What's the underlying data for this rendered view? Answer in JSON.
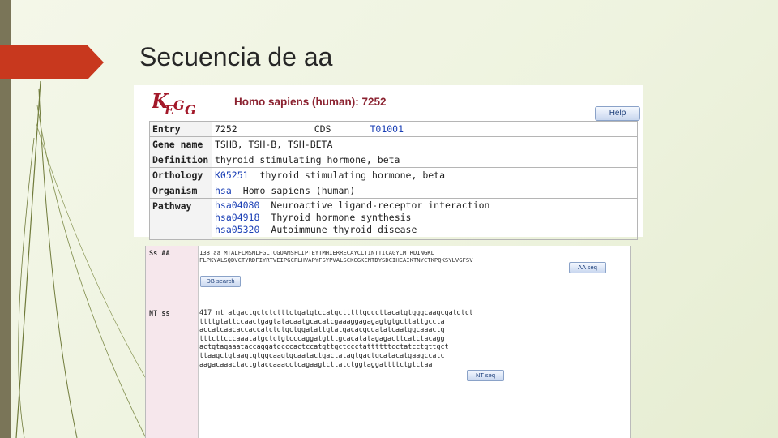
{
  "slide": {
    "title": "Secuencia de aa"
  },
  "kegg": {
    "heading": "Homo sapiens (human): 7252",
    "help_label": "Help",
    "rows": {
      "entry": {
        "label": "Entry",
        "id": "7252",
        "type": "CDS",
        "t_number": "T01001"
      },
      "gene_name": {
        "label": "Gene name",
        "value": "TSHB, TSH-B, TSH-BETA"
      },
      "definition": {
        "label": "Definition",
        "value": "thyroid stimulating hormone, beta"
      },
      "orthology": {
        "label": "Orthology",
        "ko": "K05251",
        "value": "thyroid stimulating hormone, beta"
      },
      "organism": {
        "label": "Organism",
        "code": "hsa",
        "value": "Homo sapiens (human)"
      },
      "pathway": {
        "label": "Pathway",
        "items": [
          {
            "id": "hsa04080",
            "name": "Neuroactive ligand-receptor interaction"
          },
          {
            "id": "hsa04918",
            "name": "Thyroid hormone synthesis"
          },
          {
            "id": "hsa05320",
            "name": "Autoimmune thyroid disease"
          }
        ]
      }
    }
  },
  "sequence": {
    "aa_label": "Ss AA",
    "aa_lines": [
      "138 aa MTALFLMSMLFGLTCGQAMSFCIPTEYTMHIERRECAYCLTINTTICAGYCMTRDINGKL",
      "FLPKYALSQDVCTYRDFIYRTVEIPGCPLHVAPYFSYPVALSCKCGKCNTDYSDCIHEAIKTNYCTKPQKSYLVGFSV"
    ],
    "aa_seq_button": "AA seq",
    "db_search_button": "DB search",
    "nt_label": "NT ss",
    "nt_lines": [
      "417 nt atgactgctctctttctgatgtccatgctttttggccttacatgtgggcaagcgatgtct",
      "ttttgtattccaactgagtatacaatgcacatcgaaaggagagagtgtgcttattgccta",
      "accatcaacaccaccatctgtgctggatattgtatgacacgggatatcaatggcaaactg",
      "tttcttcccaaatatgctctgtcccaggatgtttgcacatatagagacttcatctacagg",
      "actgtagaaataccaggatgcccactccatgttgctccctattttttcctatcctgttgct",
      "ttaagctgtaagtgtggcaagtgcaatactgactatagtgactgcatacatgaagccatc",
      "aagacaaactactgtaccaaacctcagaagtcttatctggtaggattttctgtctaa"
    ],
    "nt_seq_button": "NT seq"
  }
}
